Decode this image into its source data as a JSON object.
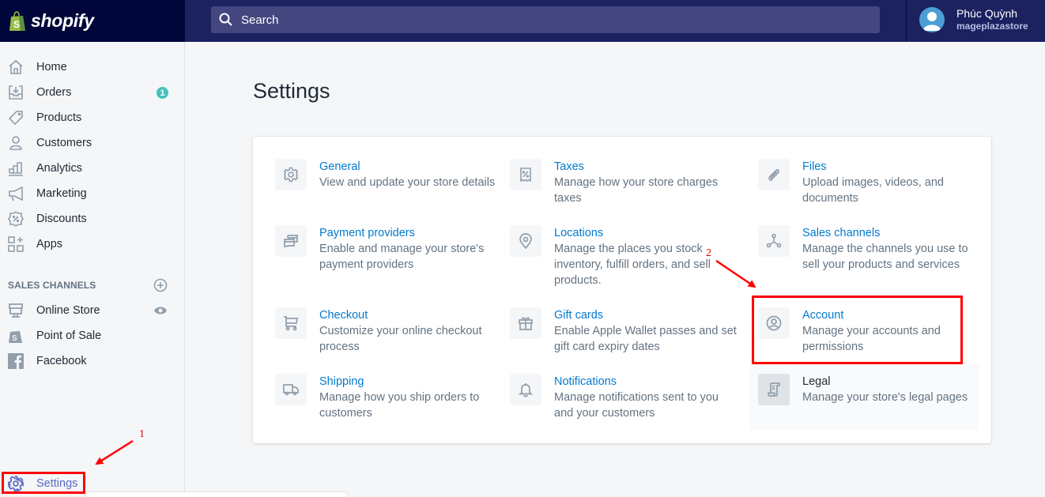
{
  "topbar": {
    "brand": "shopify",
    "search_placeholder": "Search",
    "user": {
      "name": "Phúc Quỳnh",
      "store": "mageplazastore"
    }
  },
  "sidebar": {
    "items": [
      {
        "label": "Home",
        "icon": "home-icon"
      },
      {
        "label": "Orders",
        "icon": "orders-icon",
        "badge": "1"
      },
      {
        "label": "Products",
        "icon": "tag-icon"
      },
      {
        "label": "Customers",
        "icon": "customer-icon"
      },
      {
        "label": "Analytics",
        "icon": "analytics-icon"
      },
      {
        "label": "Marketing",
        "icon": "megaphone-icon"
      },
      {
        "label": "Discounts",
        "icon": "discount-icon"
      },
      {
        "label": "Apps",
        "icon": "apps-icon"
      }
    ],
    "sales_channels_title": "SALES CHANNELS",
    "channels": [
      {
        "label": "Online Store",
        "icon": "store-icon"
      },
      {
        "label": "Point of Sale",
        "icon": "pos-bag-icon"
      },
      {
        "label": "Facebook",
        "icon": "facebook-icon"
      }
    ],
    "settings_label": "Settings"
  },
  "main": {
    "title": "Settings",
    "settings": [
      {
        "title": "General",
        "desc": "View and update your store details",
        "icon": "gear-icon"
      },
      {
        "title": "Taxes",
        "desc": "Manage how your store charges taxes",
        "icon": "tax-receipt-icon"
      },
      {
        "title": "Files",
        "desc": "Upload images, videos, and documents",
        "icon": "paperclip-icon"
      },
      {
        "title": "Payment providers",
        "desc": "Enable and manage your store's payment providers",
        "icon": "payment-cards-icon"
      },
      {
        "title": "Locations",
        "desc": "Manage the places you stock inventory, fulfill orders, and sell products.",
        "icon": "location-pin-icon"
      },
      {
        "title": "Sales channels",
        "desc": "Manage the channels you use to sell your products and services",
        "icon": "channels-icon"
      },
      {
        "title": "Checkout",
        "desc": "Customize your online checkout process",
        "icon": "cart-icon"
      },
      {
        "title": "Gift cards",
        "desc": "Enable Apple Wallet passes and set gift card expiry dates",
        "icon": "gift-icon"
      },
      {
        "title": "Account",
        "desc": "Manage your accounts and permissions",
        "icon": "account-icon"
      },
      {
        "title": "Shipping",
        "desc": "Manage how you ship orders to customers",
        "icon": "truck-icon"
      },
      {
        "title": "Notifications",
        "desc": "Manage notifications sent to you and your customers",
        "icon": "bell-icon"
      },
      {
        "title": "Legal",
        "desc": "Manage your store's legal pages",
        "icon": "legal-scroll-icon"
      }
    ]
  },
  "annotations": {
    "step1": "1",
    "step2": "2",
    "color": "#ff0000"
  }
}
